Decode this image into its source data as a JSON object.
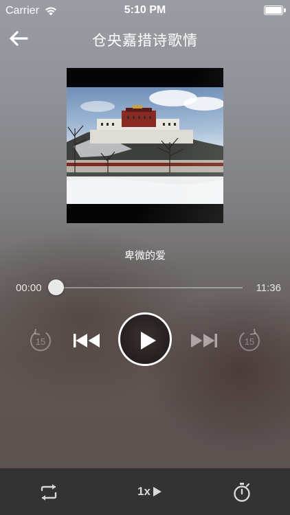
{
  "status_bar": {
    "carrier": "Carrier",
    "time": "5:10 PM"
  },
  "nav": {
    "title": "仓央嘉措诗歌情"
  },
  "player": {
    "song_title": "卑微的爱",
    "current_time": "00:00",
    "total_time": "11:36",
    "progress": 0,
    "skip_back_seconds": "15",
    "skip_forward_seconds": "15"
  },
  "bottom_bar": {
    "speed_label": "1x"
  },
  "colors": {
    "accent": "#ffffff",
    "bottom_bar_bg": "#333334"
  },
  "icons": [
    "back-arrow-icon",
    "wifi-icon",
    "battery-icon",
    "skip-back-15-icon",
    "previous-track-icon",
    "play-icon",
    "next-track-icon",
    "skip-forward-15-icon",
    "repeat-icon",
    "play-speed-icon",
    "timer-icon"
  ]
}
